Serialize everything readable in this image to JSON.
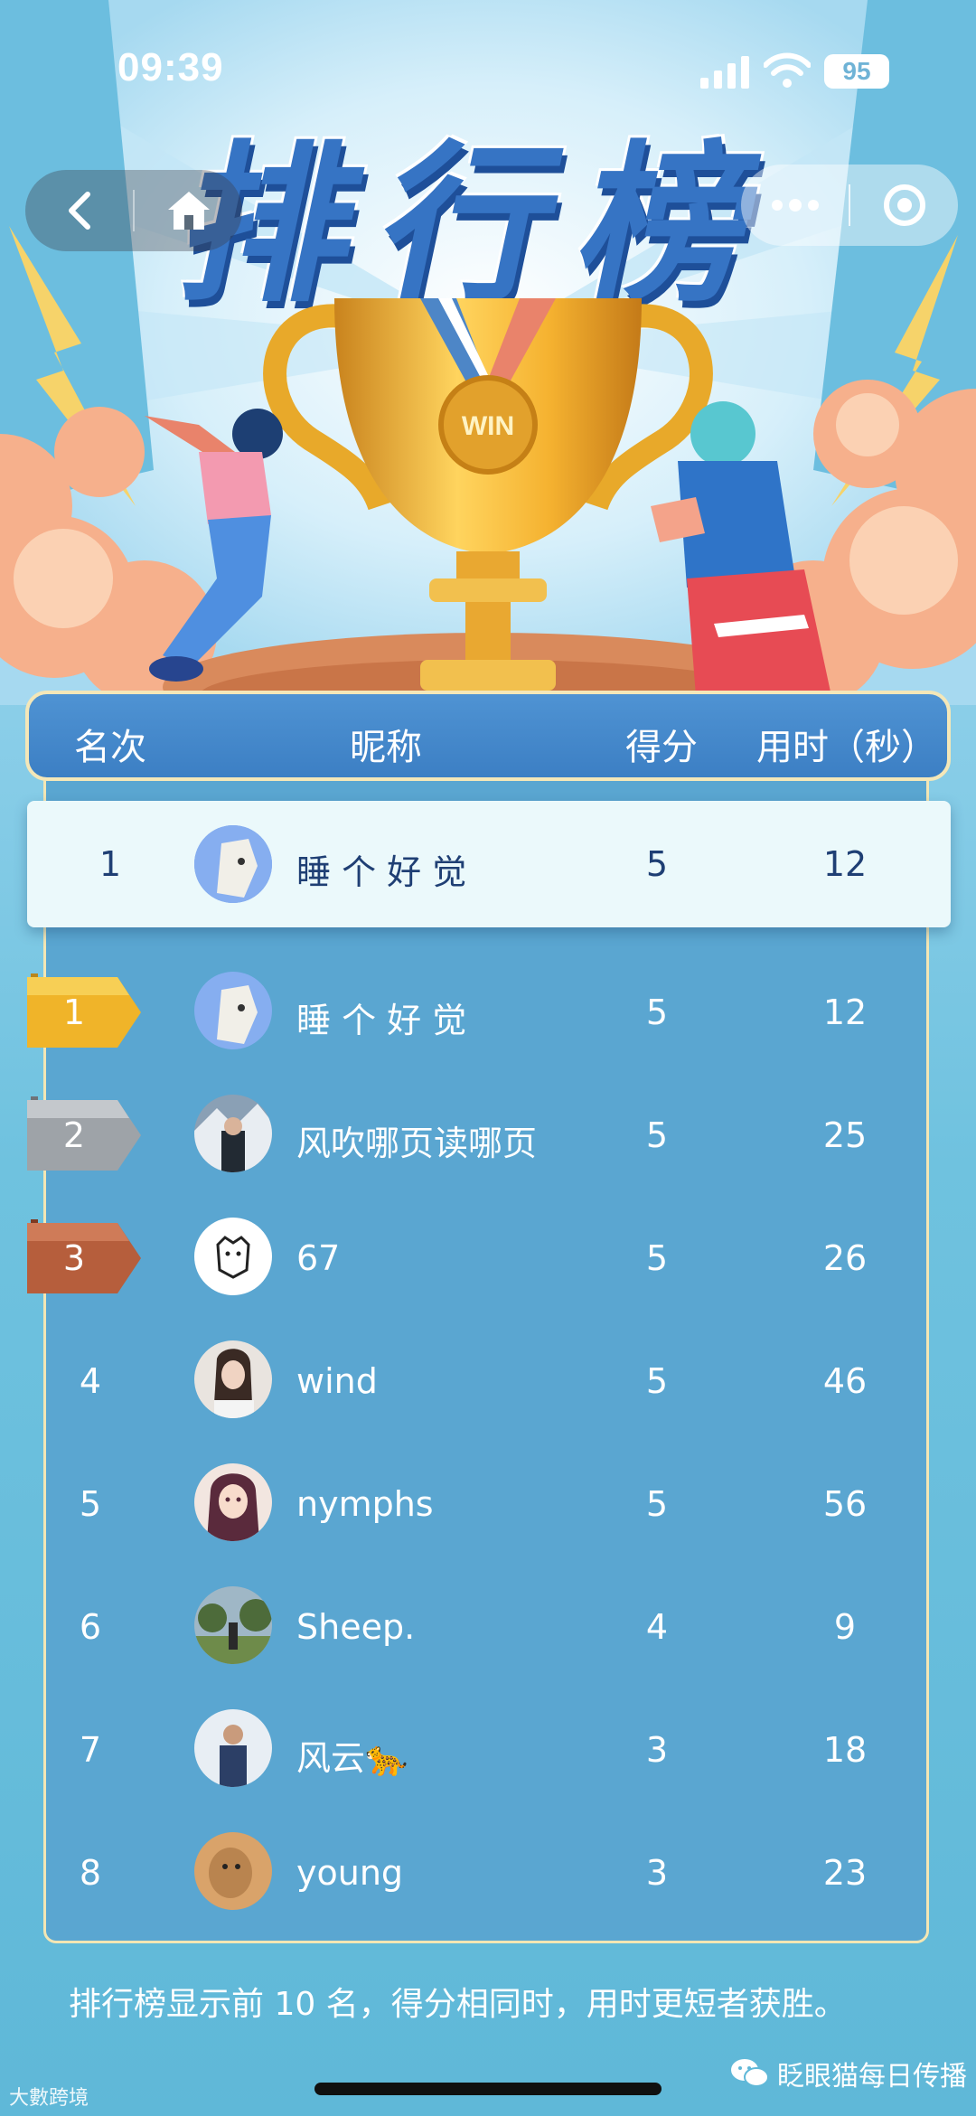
{
  "status_bar": {
    "time": "09:39",
    "battery": "95"
  },
  "hero": {
    "title": "排行榜",
    "medal_text": "WIN"
  },
  "nav": {
    "back_icon": "chevron-left-icon",
    "home_icon": "home-icon",
    "more_icon": "more-icon",
    "target_icon": "target-icon"
  },
  "table": {
    "headers": {
      "rank": "名次",
      "name": "昵称",
      "score": "得分",
      "time": "用时（秒）"
    },
    "my_row": {
      "rank": "1",
      "name": "睡 个 好 觉",
      "score": "5",
      "time": "12"
    },
    "rows": [
      {
        "rank": "1",
        "name": "睡 个 好 觉",
        "score": "5",
        "time": "12",
        "medal": "gold"
      },
      {
        "rank": "2",
        "name": "风吹哪页读哪页",
        "score": "5",
        "time": "25",
        "medal": "silver"
      },
      {
        "rank": "3",
        "name": "67",
        "score": "5",
        "time": "26",
        "medal": "bronze"
      },
      {
        "rank": "4",
        "name": "wind",
        "score": "5",
        "time": "46"
      },
      {
        "rank": "5",
        "name": "nymphs",
        "score": "5",
        "time": "56"
      },
      {
        "rank": "6",
        "name": "Sheep.",
        "score": "4",
        "time": "9"
      },
      {
        "rank": "7",
        "name": "风云🐆",
        "score": "3",
        "time": "18"
      },
      {
        "rank": "8",
        "name": "young",
        "score": "3",
        "time": "23"
      }
    ]
  },
  "footer": {
    "note": "排行榜显示前 10 名，得分相同时，用时更短者获胜。",
    "watermark_left": "大數跨境",
    "watermark_right": "眨眼猫每日传播"
  },
  "colors": {
    "gold": "#f0b429",
    "silver": "#9ea3a8",
    "bronze": "#b65e3c",
    "header": "#3f82c6",
    "panel": "#5aa6d1"
  }
}
